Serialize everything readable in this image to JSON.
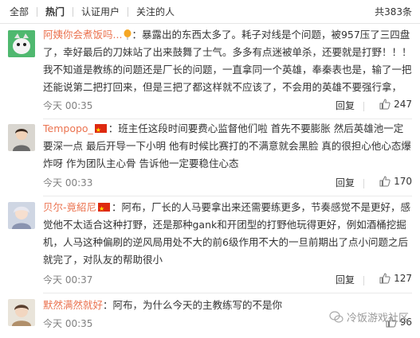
{
  "tabs": [
    {
      "label": "全部"
    },
    {
      "label": "热门"
    },
    {
      "label": "认证用户"
    },
    {
      "label": "关注的人"
    }
  ],
  "total_count": "共383条",
  "comments": [
    {
      "username": "阿姨你会煮饭吗",
      "text": "：暴露出的东西太多了。耗子对线是个问题，被957压了三四盘了，幸好最后的刀妹站了出来鼓舞了士气。多多有点迷被单杀，还要就是打野！！！我不知道是教练的问题还是厂长的问题，一直拿同一个英雄，奉秦表也是，输了一把还能说第二把打回来，但是三把了都这样就不应该了，不会用的英雄不要强行拿，",
      "time": "今天 00:35",
      "reply": "回复",
      "likes": "247"
    },
    {
      "username": "Tempopo_",
      "text": "：班主任这段时间要费心监督他们啦 首先不要膨胀 然后英雄池一定要深一点 最后开导一下小明 他有时候比赛打的不满意就会黑脸 真的很担心他心态爆炸呀 作为团队主心骨 告诉他一定要稳住心态",
      "time": "今天 00:33",
      "reply": "回复",
      "likes": "170"
    },
    {
      "username": "贝尔-竟紹尼",
      "text": "：阿布，厂长的人马要拿出来还需要练更多，节奏感觉不是更好，感觉他不太适合这种打野，还是那种gank和开团型的打野他玩得更好，例如酒桶挖掘机，人马这种偏刷的逆风局用处不大的前6级作用不大的一旦前期出了点小问题之后就完了，对队友的帮助很小",
      "time": "今天 00:37",
      "reply": "回复",
      "likes": "127"
    },
    {
      "username": "默然满然就好",
      "text": "：阿布，为什么今天的主教练写的不是你",
      "time": "今天 00:35",
      "reply": "回复",
      "likes": "96"
    }
  ],
  "watermark": "冷饭游戏社区",
  "colors": {
    "username": "#eb7350",
    "text": "#333333",
    "meta": "#808080"
  }
}
